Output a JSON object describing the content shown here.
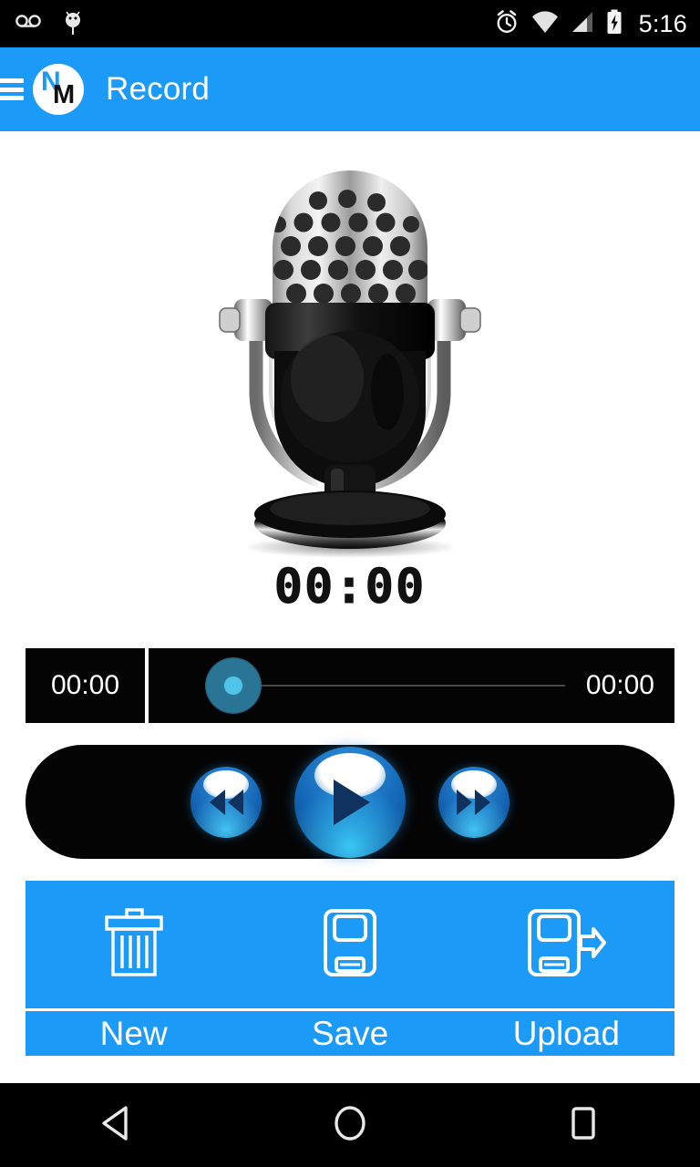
{
  "status_bar": {
    "icons": [
      "voicemail-icon",
      "android-head-icon",
      "alarm-clock-icon",
      "wifi-icon",
      "cell-signal-icon",
      "battery-charging-icon"
    ],
    "time": "5:16"
  },
  "app_bar": {
    "menu_icon": "hamburger-menu-icon",
    "logo": {
      "letter_primary": "N",
      "letter_secondary": "M"
    },
    "title": "Record"
  },
  "main": {
    "microphone_icon": "microphone-illustration",
    "timer": "00:00",
    "seek": {
      "elapsed": "00:00",
      "remaining": "00:00",
      "progress_percent": 0
    },
    "transport": {
      "rewind_label": "rewind-button",
      "play_label": "play-button",
      "forward_label": "fast-forward-button"
    },
    "actions": [
      {
        "icon": "trash-icon",
        "label": "New"
      },
      {
        "icon": "save-floppy-icon",
        "label": "Save"
      },
      {
        "icon": "upload-floppy-arrow-icon",
        "label": "Upload"
      }
    ]
  },
  "nav_bar": {
    "back": "back-triangle-icon",
    "home": "home-circle-icon",
    "recents": "recents-square-icon"
  },
  "colors": {
    "accent": "#1b9af7",
    "status_bg": "#000000",
    "panel_bg": "#040404",
    "text_on_accent": "#ffffff"
  }
}
